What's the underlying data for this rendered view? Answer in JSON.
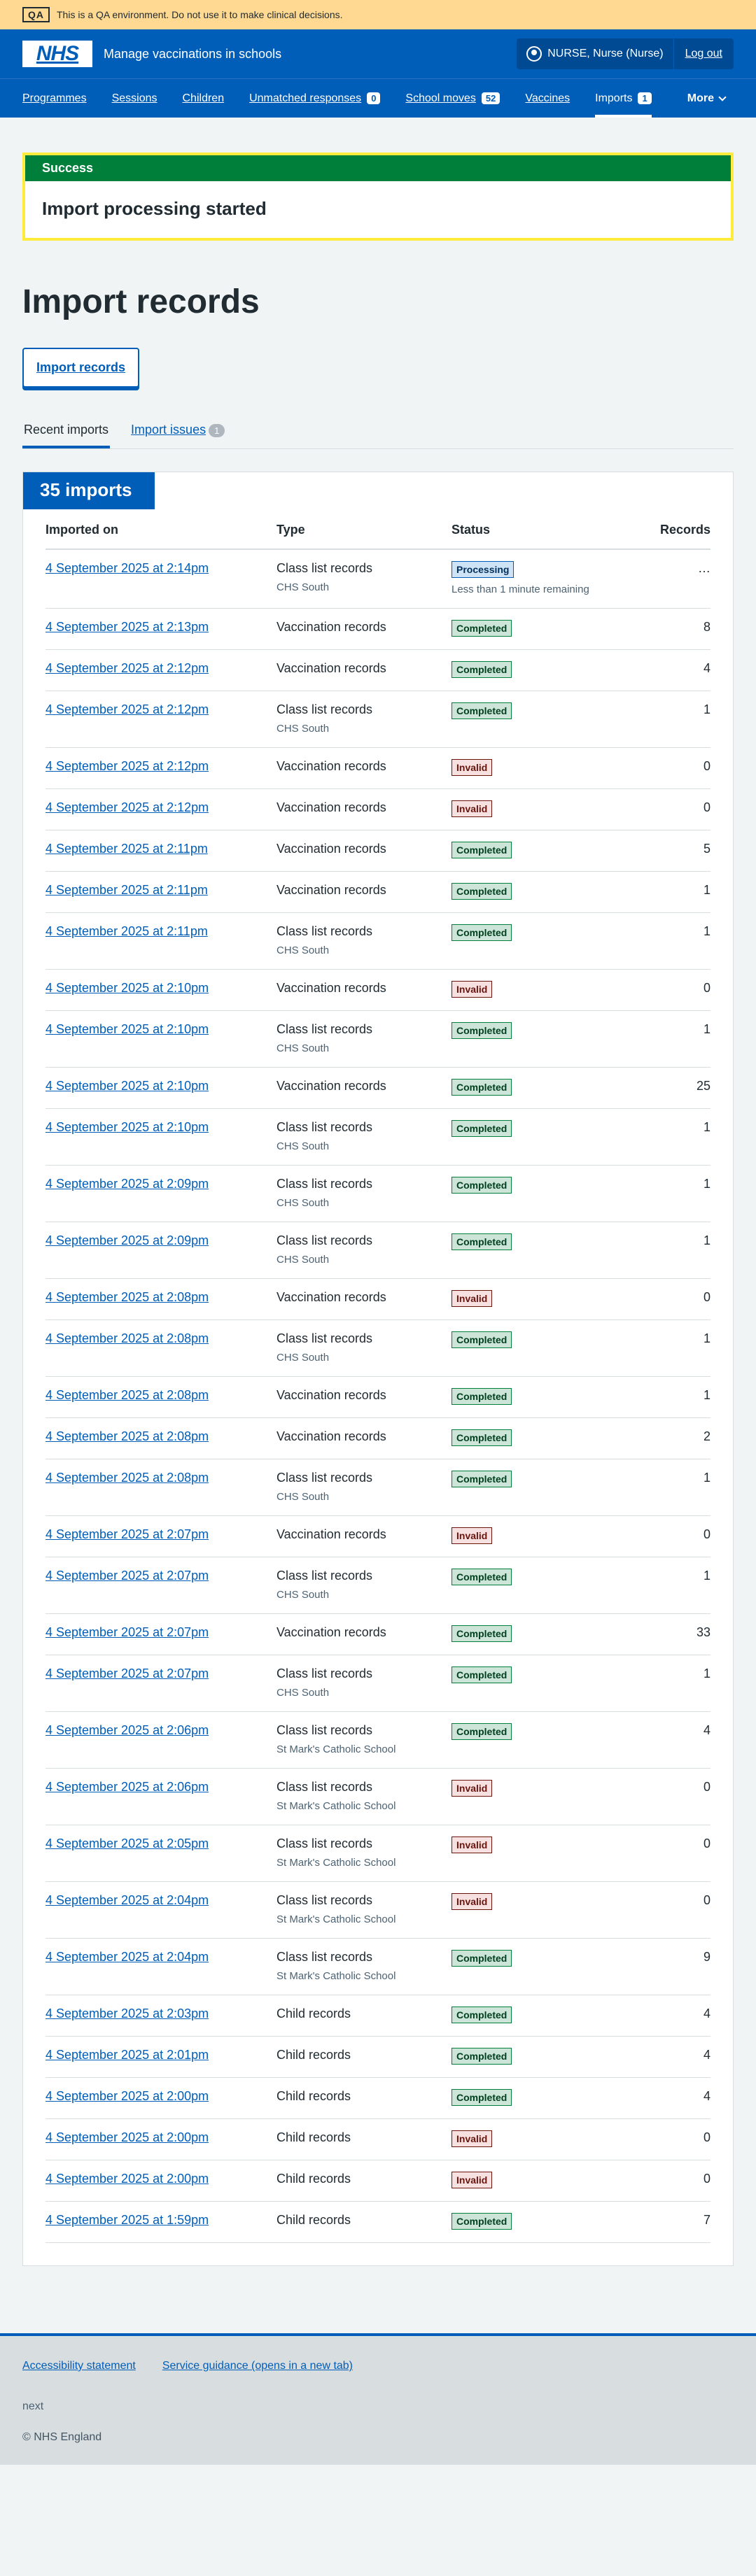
{
  "qa_banner": {
    "tag": "QA",
    "text": "This is a QA environment. Do not use it to make clinical decisions."
  },
  "header": {
    "logo": "NHS",
    "service_name": "Manage vaccinations in schools",
    "user": "NURSE, Nurse (Nurse)",
    "logout": "Log out"
  },
  "nav": {
    "programmes": "Programmes",
    "sessions": "Sessions",
    "children": "Children",
    "unmatched": "Unmatched responses",
    "unmatched_count": "0",
    "school_moves": "School moves",
    "school_moves_count": "52",
    "vaccines": "Vaccines",
    "imports": "Imports",
    "imports_count": "1",
    "more": "More"
  },
  "alert": {
    "heading": "Success",
    "message": "Import processing started"
  },
  "page_title": "Import records",
  "import_button": "Import records",
  "tabs": {
    "recent": "Recent imports",
    "issues": "Import issues",
    "issues_count": "1"
  },
  "card": {
    "heading": "35 imports",
    "columns": {
      "imported_on": "Imported on",
      "type": "Type",
      "status": "Status",
      "records": "Records"
    },
    "rows": [
      {
        "date": "4 September 2025 at 2:14pm",
        "type": "Class list records",
        "sub": "CHS South",
        "status": "Processing",
        "note": "Less than 1 minute remaining",
        "records": "…"
      },
      {
        "date": "4 September 2025 at 2:13pm",
        "type": "Vaccination records",
        "sub": "",
        "status": "Completed",
        "note": "",
        "records": "8"
      },
      {
        "date": "4 September 2025 at 2:12pm",
        "type": "Vaccination records",
        "sub": "",
        "status": "Completed",
        "note": "",
        "records": "4"
      },
      {
        "date": "4 September 2025 at 2:12pm",
        "type": "Class list records",
        "sub": "CHS South",
        "status": "Completed",
        "note": "",
        "records": "1"
      },
      {
        "date": "4 September 2025 at 2:12pm",
        "type": "Vaccination records",
        "sub": "",
        "status": "Invalid",
        "note": "",
        "records": "0"
      },
      {
        "date": "4 September 2025 at 2:12pm",
        "type": "Vaccination records",
        "sub": "",
        "status": "Invalid",
        "note": "",
        "records": "0"
      },
      {
        "date": "4 September 2025 at 2:11pm",
        "type": "Vaccination records",
        "sub": "",
        "status": "Completed",
        "note": "",
        "records": "5"
      },
      {
        "date": "4 September 2025 at 2:11pm",
        "type": "Vaccination records",
        "sub": "",
        "status": "Completed",
        "note": "",
        "records": "1"
      },
      {
        "date": "4 September 2025 at 2:11pm",
        "type": "Class list records",
        "sub": "CHS South",
        "status": "Completed",
        "note": "",
        "records": "1"
      },
      {
        "date": "4 September 2025 at 2:10pm",
        "type": "Vaccination records",
        "sub": "",
        "status": "Invalid",
        "note": "",
        "records": "0"
      },
      {
        "date": "4 September 2025 at 2:10pm",
        "type": "Class list records",
        "sub": "CHS South",
        "status": "Completed",
        "note": "",
        "records": "1"
      },
      {
        "date": "4 September 2025 at 2:10pm",
        "type": "Vaccination records",
        "sub": "",
        "status": "Completed",
        "note": "",
        "records": "25"
      },
      {
        "date": "4 September 2025 at 2:10pm",
        "type": "Class list records",
        "sub": "CHS South",
        "status": "Completed",
        "note": "",
        "records": "1"
      },
      {
        "date": "4 September 2025 at 2:09pm",
        "type": "Class list records",
        "sub": "CHS South",
        "status": "Completed",
        "note": "",
        "records": "1"
      },
      {
        "date": "4 September 2025 at 2:09pm",
        "type": "Class list records",
        "sub": "CHS South",
        "status": "Completed",
        "note": "",
        "records": "1"
      },
      {
        "date": "4 September 2025 at 2:08pm",
        "type": "Vaccination records",
        "sub": "",
        "status": "Invalid",
        "note": "",
        "records": "0"
      },
      {
        "date": "4 September 2025 at 2:08pm",
        "type": "Class list records",
        "sub": "CHS South",
        "status": "Completed",
        "note": "",
        "records": "1"
      },
      {
        "date": "4 September 2025 at 2:08pm",
        "type": "Vaccination records",
        "sub": "",
        "status": "Completed",
        "note": "",
        "records": "1"
      },
      {
        "date": "4 September 2025 at 2:08pm",
        "type": "Vaccination records",
        "sub": "",
        "status": "Completed",
        "note": "",
        "records": "2"
      },
      {
        "date": "4 September 2025 at 2:08pm",
        "type": "Class list records",
        "sub": "CHS South",
        "status": "Completed",
        "note": "",
        "records": "1"
      },
      {
        "date": "4 September 2025 at 2:07pm",
        "type": "Vaccination records",
        "sub": "",
        "status": "Invalid",
        "note": "",
        "records": "0"
      },
      {
        "date": "4 September 2025 at 2:07pm",
        "type": "Class list records",
        "sub": "CHS South",
        "status": "Completed",
        "note": "",
        "records": "1"
      },
      {
        "date": "4 September 2025 at 2:07pm",
        "type": "Vaccination records",
        "sub": "",
        "status": "Completed",
        "note": "",
        "records": "33"
      },
      {
        "date": "4 September 2025 at 2:07pm",
        "type": "Class list records",
        "sub": "CHS South",
        "status": "Completed",
        "note": "",
        "records": "1"
      },
      {
        "date": "4 September 2025 at 2:06pm",
        "type": "Class list records",
        "sub": "St Mark's Catholic School",
        "status": "Completed",
        "note": "",
        "records": "4"
      },
      {
        "date": "4 September 2025 at 2:06pm",
        "type": "Class list records",
        "sub": "St Mark's Catholic School",
        "status": "Invalid",
        "note": "",
        "records": "0"
      },
      {
        "date": "4 September 2025 at 2:05pm",
        "type": "Class list records",
        "sub": "St Mark's Catholic School",
        "status": "Invalid",
        "note": "",
        "records": "0"
      },
      {
        "date": "4 September 2025 at 2:04pm",
        "type": "Class list records",
        "sub": "St Mark's Catholic School",
        "status": "Invalid",
        "note": "",
        "records": "0"
      },
      {
        "date": "4 September 2025 at 2:04pm",
        "type": "Class list records",
        "sub": "St Mark's Catholic School",
        "status": "Completed",
        "note": "",
        "records": "9"
      },
      {
        "date": "4 September 2025 at 2:03pm",
        "type": "Child records",
        "sub": "",
        "status": "Completed",
        "note": "",
        "records": "4"
      },
      {
        "date": "4 September 2025 at 2:01pm",
        "type": "Child records",
        "sub": "",
        "status": "Completed",
        "note": "",
        "records": "4"
      },
      {
        "date": "4 September 2025 at 2:00pm",
        "type": "Child records",
        "sub": "",
        "status": "Completed",
        "note": "",
        "records": "4"
      },
      {
        "date": "4 September 2025 at 2:00pm",
        "type": "Child records",
        "sub": "",
        "status": "Invalid",
        "note": "",
        "records": "0"
      },
      {
        "date": "4 September 2025 at 2:00pm",
        "type": "Child records",
        "sub": "",
        "status": "Invalid",
        "note": "",
        "records": "0"
      },
      {
        "date": "4 September 2025 at 1:59pm",
        "type": "Child records",
        "sub": "",
        "status": "Completed",
        "note": "",
        "records": "7"
      }
    ]
  },
  "footer": {
    "accessibility": "Accessibility statement",
    "guidance": "Service guidance (opens in a new tab)",
    "env": "next",
    "copyright": "© NHS England"
  }
}
